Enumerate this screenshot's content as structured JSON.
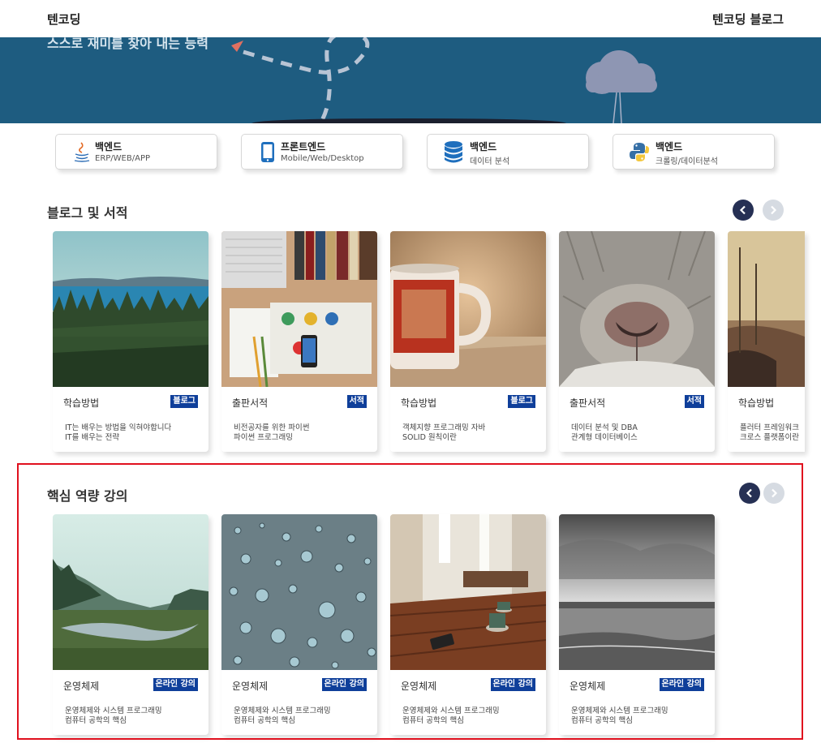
{
  "header": {
    "brand": "텐코딩",
    "blog_link": "텐코딩 블로그"
  },
  "hero": {
    "tagline": "스스로 재미를 찾아 내는 능력"
  },
  "categories": [
    {
      "title": "백엔드",
      "subtitle": "ERP/WEB/APP",
      "icon": "java-icon"
    },
    {
      "title": "프론트엔드",
      "subtitle": "Mobile/Web/Desktop",
      "icon": "mobile-icon"
    },
    {
      "title": "백엔드",
      "subtitle": "데이터 분석",
      "icon": "database-icon"
    },
    {
      "title": "백엔드",
      "subtitle": "크롤링/데이터분석",
      "icon": "python-icon"
    }
  ],
  "blog_section": {
    "title": "블로그 및 서적",
    "cards": [
      {
        "category": "학습방법",
        "badge": "블로그",
        "line1": "IT는 배우는 방법을 익혀야합니다",
        "line2": "IT를 배우는 전략"
      },
      {
        "category": "출판서적",
        "badge": "서적",
        "line1": "비전공자를 위한 파이썬",
        "line2": "파이썬 프로그래밍"
      },
      {
        "category": "학습방법",
        "badge": "블로그",
        "line1": "객체지향 프로그래밍 자바",
        "line2": "SOLID 원칙이란"
      },
      {
        "category": "출판서적",
        "badge": "서적",
        "line1": "데이터 분석 및 DBA",
        "line2": "관계형 데이터베이스"
      },
      {
        "category": "학습방법",
        "badge": "",
        "line1": "플러터 프레임워크",
        "line2": "크로스 플랫폼이란"
      }
    ]
  },
  "lecture_section": {
    "title": "핵심 역량 강의",
    "cards": [
      {
        "category": "운영체제",
        "badge": "온라인 강의",
        "line1": "운영체제와 시스템 프로그래밍",
        "line2": "컴퓨터 공학의 핵심"
      },
      {
        "category": "운영체제",
        "badge": "온라인 강의",
        "line1": "운영체제와 시스템 프로그래밍",
        "line2": "컴퓨터 공학의 핵심"
      },
      {
        "category": "운영체제",
        "badge": "온라인 강의",
        "line1": "운영체제와 시스템 프로그래밍",
        "line2": "컴퓨터 공학의 핵심"
      },
      {
        "category": "운영체제",
        "badge": "온라인 강의",
        "line1": "운영체제와 시스템 프로그래밍",
        "line2": "컴퓨터 공학의 핵심"
      }
    ]
  },
  "colors": {
    "hero_bg": "#1e5c80",
    "badge_bg": "#0f3f9a",
    "nav_active": "#263054",
    "highlight": "#e0101e"
  }
}
